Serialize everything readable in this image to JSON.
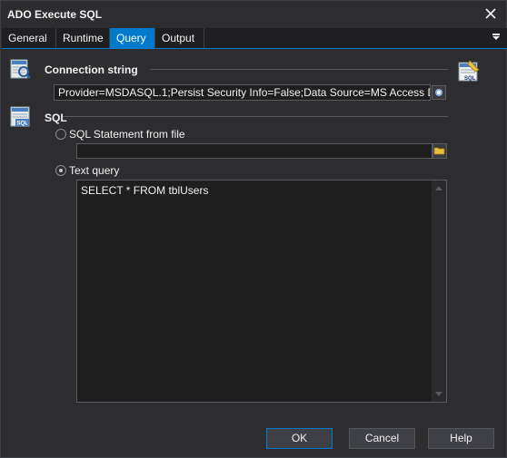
{
  "window": {
    "title": "ADO Execute SQL"
  },
  "tabs": [
    {
      "label": "General"
    },
    {
      "label": "Runtime"
    },
    {
      "label": "Query"
    },
    {
      "label": "Output"
    }
  ],
  "active_tab": "Query",
  "connection": {
    "heading": "Connection string",
    "value": "Provider=MSDASQL.1;Persist Security Info=False;Data Source=MS Access Database"
  },
  "sql": {
    "heading": "SQL",
    "option_file_label": "SQL Statement from file",
    "option_file_checked": false,
    "file_path": "",
    "option_text_label": "Text query",
    "option_text_checked": true,
    "query_text": "SELECT * FROM tblUsers"
  },
  "buttons": {
    "ok": "OK",
    "cancel": "Cancel",
    "help": "Help"
  },
  "colors": {
    "accent": "#007acc",
    "background": "#2d2d30",
    "field": "#1e1e1e"
  }
}
